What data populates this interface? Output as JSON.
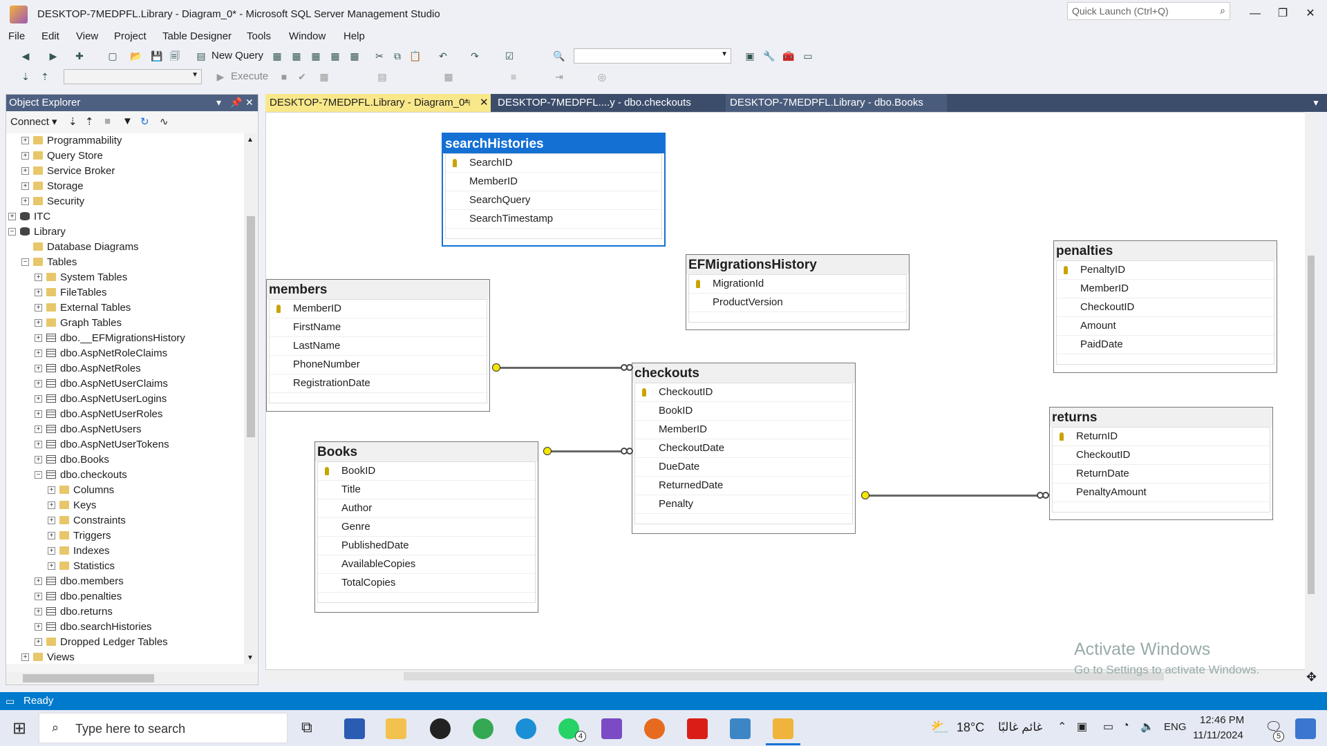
{
  "window": {
    "title": "DESKTOP-7MEDPFL.Library - Diagram_0* - Microsoft SQL Server Management Studio",
    "quick_launch": "Quick Launch (Ctrl+Q)"
  },
  "menu": [
    "File",
    "Edit",
    "View",
    "Project",
    "Table Designer",
    "Tools",
    "Window",
    "Help"
  ],
  "toolbar": {
    "new_query": "New Query",
    "execute": "Execute"
  },
  "object_explorer": {
    "title": "Object Explorer",
    "connect": "Connect",
    "tree": [
      "Programmability",
      "Query Store",
      "Service Broker",
      "Storage",
      "Security",
      "ITC",
      "Library",
      "Database Diagrams",
      "Tables",
      "System Tables",
      "FileTables",
      "External Tables",
      "Graph Tables",
      "dbo.__EFMigrationsHistory",
      "dbo.AspNetRoleClaims",
      "dbo.AspNetRoles",
      "dbo.AspNetUserClaims",
      "dbo.AspNetUserLogins",
      "dbo.AspNetUserRoles",
      "dbo.AspNetUsers",
      "dbo.AspNetUserTokens",
      "dbo.Books",
      "dbo.checkouts",
      "Columns",
      "Keys",
      "Constraints",
      "Triggers",
      "Indexes",
      "Statistics",
      "dbo.members",
      "dbo.penalties",
      "dbo.returns",
      "dbo.searchHistories",
      "Dropped Ledger Tables",
      "Views"
    ]
  },
  "tabs": [
    "DESKTOP-7MEDPFL.Library - Diagram_0*",
    "DESKTOP-7MEDPFL....y - dbo.checkouts",
    "DESKTOP-7MEDPFL.Library - dbo.Books"
  ],
  "entities": {
    "searchHistories": {
      "name": "searchHistories",
      "columns": [
        "SearchID",
        "MemberID",
        "SearchQuery",
        "SearchTimestamp"
      ]
    },
    "efmig": {
      "name": "EFMigrationsHistory",
      "columns": [
        "MigrationId",
        "ProductVersion"
      ]
    },
    "penalties": {
      "name": "penalties",
      "columns": [
        "PenaltyID",
        "MemberID",
        "CheckoutID",
        "Amount",
        "PaidDate"
      ]
    },
    "members": {
      "name": "members",
      "columns": [
        "MemberID",
        "FirstName",
        "LastName",
        "PhoneNumber",
        "RegistrationDate"
      ]
    },
    "checkouts": {
      "name": "checkouts",
      "columns": [
        "CheckoutID",
        "BookID",
        "MemberID",
        "CheckoutDate",
        "DueDate",
        "ReturnedDate",
        "Penalty"
      ]
    },
    "returns": {
      "name": "returns",
      "columns": [
        "ReturnID",
        "CheckoutID",
        "ReturnDate",
        "PenaltyAmount"
      ]
    },
    "books": {
      "name": "Books",
      "columns": [
        "BookID",
        "Title",
        "Author",
        "Genre",
        "PublishedDate",
        "AvailableCopies",
        "TotalCopies"
      ]
    }
  },
  "watermark": {
    "line1": "Activate Windows",
    "line2": "Go to Settings to activate Windows."
  },
  "status": "Ready",
  "taskbar": {
    "search": "Type here to search",
    "weather": "18°C",
    "weather_desc": "غائم غالبًا",
    "lang": "ENG",
    "time": "12:46 PM",
    "date": "11/11/2024",
    "whatsapp_badge": "4",
    "notif_badge": "5"
  }
}
